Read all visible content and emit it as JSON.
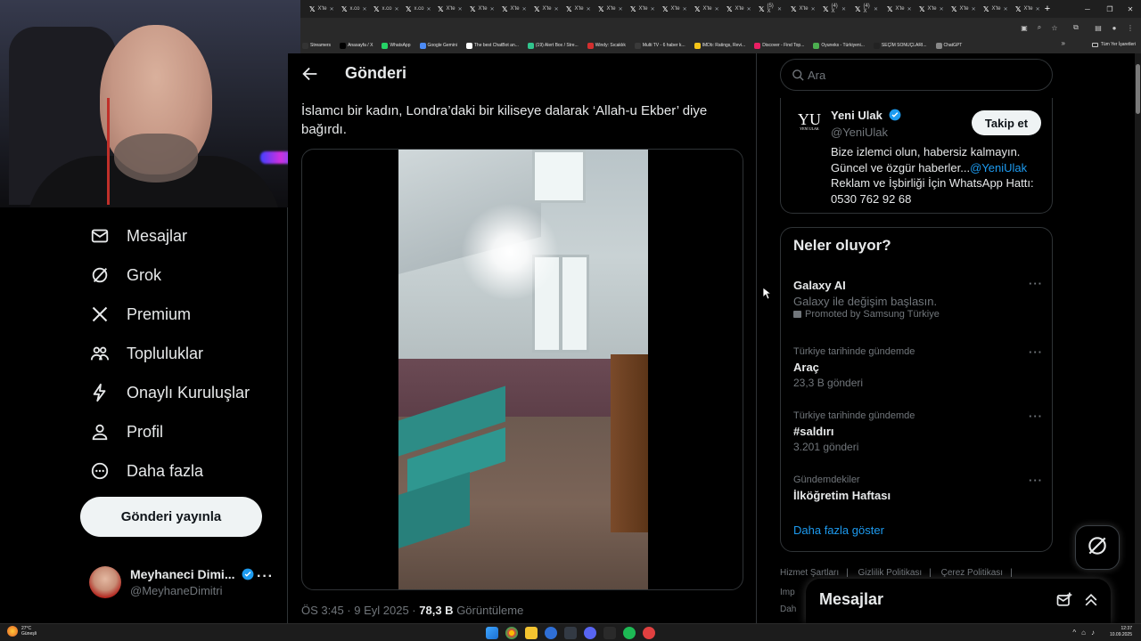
{
  "browser": {
    "tabs": [
      {
        "label": "X'te"
      },
      {
        "label": "x.co"
      },
      {
        "label": "x.co"
      },
      {
        "label": "x.co"
      },
      {
        "label": "X'te"
      },
      {
        "label": "X'te"
      },
      {
        "label": "X'te"
      },
      {
        "label": "X'te"
      },
      {
        "label": "X'te"
      },
      {
        "label": "X'te"
      },
      {
        "label": "X'te"
      },
      {
        "label": "X'te"
      },
      {
        "label": "X'te"
      },
      {
        "label": "X'te"
      },
      {
        "label": "(5) X"
      },
      {
        "label": "X'te"
      },
      {
        "label": "(4) X"
      },
      {
        "label": "(4) X"
      },
      {
        "label": "X'te"
      },
      {
        "label": "X'te"
      },
      {
        "label": "X'te"
      },
      {
        "label": "X'te"
      },
      {
        "label": "X'te"
      }
    ],
    "bookmarks": [
      {
        "label": "Streamers",
        "color": "#333333"
      },
      {
        "label": "Anasayfa / X",
        "color": "#000000"
      },
      {
        "label": "WhatsApp",
        "color": "#25d366"
      },
      {
        "label": "Google Gemini",
        "color": "#4c8bf5"
      },
      {
        "label": "The best ChatBot an...",
        "color": "#ffffff"
      },
      {
        "label": "(19) Alert Box / Stre...",
        "color": "#31c48d"
      },
      {
        "label": "Windy: Sıcaklık",
        "color": "#d32f2f"
      },
      {
        "label": "Multi TV - 6 haber k...",
        "color": "#3a3a3a"
      },
      {
        "label": "IMDb: Ratings, Revi...",
        "color": "#f5c518"
      },
      {
        "label": "Discover - Find Top...",
        "color": "#e91e63"
      },
      {
        "label": "Oyuneks - Türkiyeni...",
        "color": "#4caf50"
      },
      {
        "label": "SEÇİM SONUÇLARI...",
        "color": "#222222"
      },
      {
        "label": "ChatGPT",
        "color": "#888888"
      }
    ],
    "all_bookmarks_label": "Tüm Yer İşaretleri"
  },
  "nav": {
    "items": [
      {
        "label": "Mesajlar",
        "icon": "mail-icon"
      },
      {
        "label": "Grok",
        "icon": "grok-icon"
      },
      {
        "label": "Premium",
        "icon": "x-logo-icon"
      },
      {
        "label": "Topluluklar",
        "icon": "communities-icon"
      },
      {
        "label": "Onaylı Kuruluşlar",
        "icon": "lightning-icon"
      },
      {
        "label": "Profil",
        "icon": "person-icon"
      },
      {
        "label": "Daha fazla",
        "icon": "more-circle-icon"
      }
    ],
    "post_button": "Gönderi yayınla",
    "account": {
      "name": "Meyhaneci Dimi...",
      "handle": "@MeyhaneDimitri",
      "more": "···"
    }
  },
  "main": {
    "header_title": "Gönderi",
    "post_text": "İslamcı bir kadın, Londra’daki bir kiliseye dalarak ‘Allah-u Ekber’ diye bağırdı.",
    "meta_time": "ÖS 3:45 · 9 Eyl 2025 ·",
    "meta_views_number": "78,3 B",
    "meta_views_label": "Görüntüleme"
  },
  "sidebar": {
    "search_placeholder": "Ara",
    "profile": {
      "logo_text": "YU",
      "logo_sub": "YENİ ULAK",
      "name": "Yeni Ulak",
      "handle": "@YeniUlak",
      "follow_label": "Takip et",
      "bio_line1": "Bize izlemci olun, habersiz kalmayın. Güncel ve özgür haberler...",
      "bio_link": "@YeniUlak",
      "bio_line2": "Reklam ve İşbirliği İçin WhatsApp Hattı: 0530 762 92 68"
    },
    "trends": {
      "title": "Neler oluyor?",
      "items": [
        {
          "context": "",
          "name": "Galaxy AI",
          "sub": "Galaxy ile değişim başlasın.",
          "promo": "Promoted by Samsung Türkiye"
        },
        {
          "context": "Türkiye tarihinde gündemde",
          "name": "Araç",
          "sub": "23,3 B gönderi",
          "promo": ""
        },
        {
          "context": "Türkiye tarihinde gündemde",
          "name": "#saldırı",
          "sub": "3.201 gönderi",
          "promo": ""
        },
        {
          "context": "Gündemdekiler",
          "name": "İlköğretim Haftası",
          "sub": "",
          "promo": ""
        }
      ],
      "show_more": "Daha fazla göster",
      "more_dots": "···"
    },
    "footer_links": [
      "Hizmet Şartları",
      "Gizlilik Politikası",
      "Çerez Politikası"
    ],
    "footer_frag1": "Imp",
    "footer_frag2": "Dah",
    "messages_drawer_title": "Mesajlar"
  },
  "taskbar": {
    "weather_temp": "27°C",
    "weather_desc": "Güneşli",
    "time": "12:37",
    "date": "10.09.2025"
  },
  "colors": {
    "accent": "#1d9bf0",
    "text": "#e7e9ea",
    "muted": "#71767b",
    "border": "#2f3336"
  }
}
